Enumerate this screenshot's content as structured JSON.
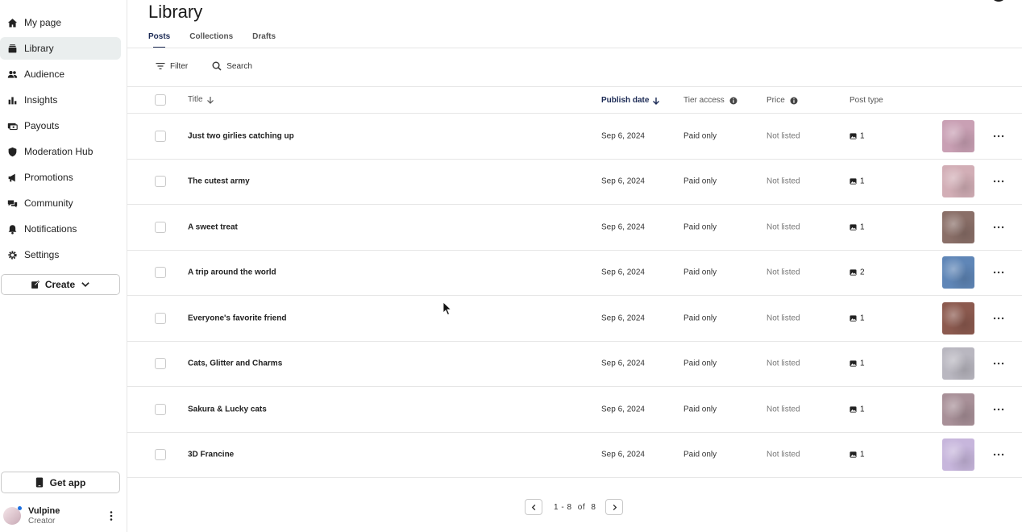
{
  "sidebar": {
    "items": [
      {
        "label": "My page",
        "icon": "home-icon"
      },
      {
        "label": "Library",
        "icon": "library-icon",
        "active": true
      },
      {
        "label": "Audience",
        "icon": "audience-icon"
      },
      {
        "label": "Insights",
        "icon": "insights-icon"
      },
      {
        "label": "Payouts",
        "icon": "payouts-icon"
      },
      {
        "label": "Moderation Hub",
        "icon": "shield-icon"
      },
      {
        "label": "Promotions",
        "icon": "megaphone-icon"
      },
      {
        "label": "Community",
        "icon": "community-icon"
      },
      {
        "label": "Notifications",
        "icon": "bell-icon"
      },
      {
        "label": "Settings",
        "icon": "gear-icon"
      }
    ],
    "create_label": "Create",
    "get_app_label": "Get app",
    "user": {
      "name": "Vulpine",
      "role": "Creator"
    }
  },
  "header": {
    "title": "Library",
    "tabs": [
      {
        "label": "Posts",
        "active": true
      },
      {
        "label": "Collections"
      },
      {
        "label": "Drafts"
      }
    ]
  },
  "toolbar": {
    "filter_label": "Filter",
    "search_label": "Search"
  },
  "table": {
    "columns": {
      "title": "Title",
      "publish_date": "Publish date",
      "tier_access": "Tier access",
      "price": "Price",
      "post_type": "Post type"
    },
    "rows": [
      {
        "title": "Just two girlies catching up",
        "date": "Sep 6, 2024",
        "tier": "Paid only",
        "price": "Not listed",
        "count": "1",
        "thumb_color": "#c9a0b4"
      },
      {
        "title": "The cutest army",
        "date": "Sep 6, 2024",
        "tier": "Paid only",
        "price": "Not listed",
        "count": "1",
        "thumb_color": "#d2aeb6"
      },
      {
        "title": "A sweet treat",
        "date": "Sep 6, 2024",
        "tier": "Paid only",
        "price": "Not listed",
        "count": "1",
        "thumb_color": "#8a6f68"
      },
      {
        "title": "A trip around the world",
        "date": "Sep 6, 2024",
        "tier": "Paid only",
        "price": "Not listed",
        "count": "2",
        "thumb_color": "#5f86b7"
      },
      {
        "title": "Everyone's favorite friend",
        "date": "Sep 6, 2024",
        "tier": "Paid only",
        "price": "Not listed",
        "count": "1",
        "thumb_color": "#8c5a4f"
      },
      {
        "title": "Cats, Glitter and Charms",
        "date": "Sep 6, 2024",
        "tier": "Paid only",
        "price": "Not listed",
        "count": "1",
        "thumb_color": "#b9b7c0"
      },
      {
        "title": "Sakura & Lucky cats",
        "date": "Sep 6, 2024",
        "tier": "Paid only",
        "price": "Not listed",
        "count": "1",
        "thumb_color": "#a89098"
      },
      {
        "title": "3D Francine",
        "date": "Sep 6, 2024",
        "tier": "Paid only",
        "price": "Not listed",
        "count": "1",
        "thumb_color": "#c7b6dc"
      }
    ]
  },
  "pagination": {
    "start": "1",
    "end": "8",
    "of_label": "of",
    "total": "8"
  },
  "colors": {
    "accent": "#1b2a55",
    "active_nav_bg": "#eaeeee",
    "border": "#e6e6e6"
  }
}
